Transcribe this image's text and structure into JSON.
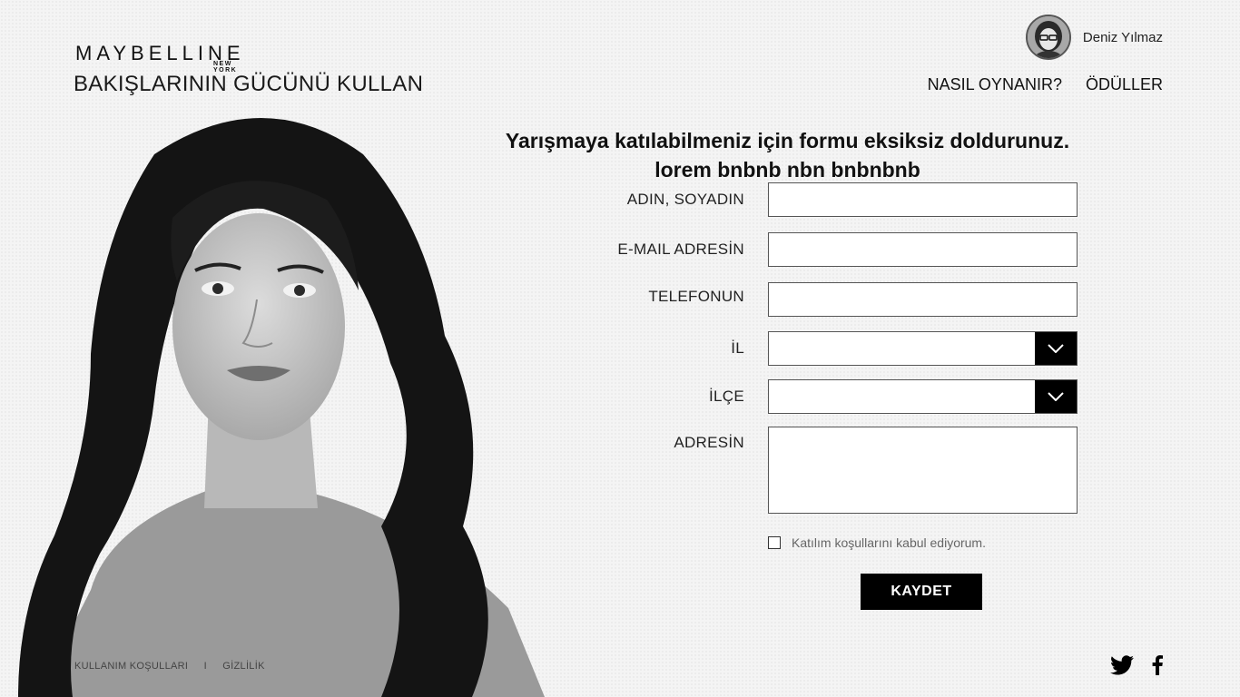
{
  "brand": {
    "name": "MAYBELLINE",
    "sub": "NEW YORK",
    "tagline": "BAKIŞLARININ GÜCÜNÜ KULLAN"
  },
  "user": {
    "name": "Deniz Yılmaz"
  },
  "nav": {
    "how_to_play": "NASIL OYNANIR?",
    "prizes": "ÖDÜLLER"
  },
  "form": {
    "heading_line1": "Yarışmaya katılabilmeniz için formu eksiksiz doldurunuz.",
    "heading_line2": "lorem bnbnb nbn bnbnbnb",
    "name_label": "ADIN, SOYADIN",
    "email_label": "E-MAIL ADRESİN",
    "phone_label": "TELEFONUN",
    "city_label": "İL",
    "district_label": "İLÇE",
    "address_label": "ADRESİN",
    "terms_text": "Katılım koşullarını kabul ediyorum.",
    "save_label": "KAYDET"
  },
  "footer": {
    "terms_link": "KULLANIM KOŞULLARI",
    "separator": "I",
    "privacy_link": "GİZLİLİK"
  },
  "social": [
    "twitter-icon",
    "facebook-icon"
  ],
  "colors": {
    "button_bg": "#000000",
    "background": "#f4f4f4"
  }
}
